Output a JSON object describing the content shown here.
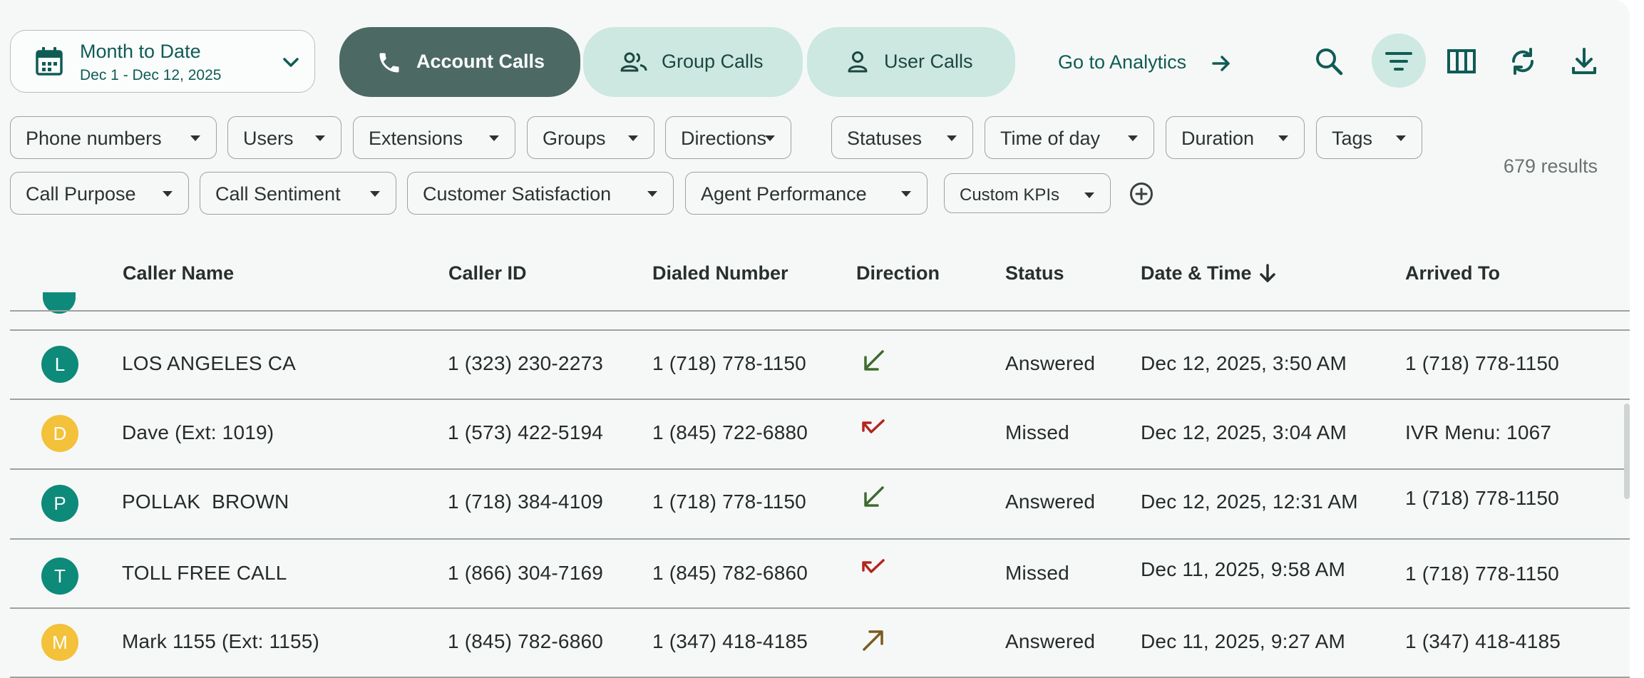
{
  "date_range": {
    "label": "Month to Date",
    "range": "Dec 1 - Dec 12, 2025"
  },
  "view_tabs": [
    {
      "label": "Account Calls",
      "active": true
    },
    {
      "label": "Group Calls",
      "active": false
    },
    {
      "label": "User Calls",
      "active": false
    }
  ],
  "analytics_link": "Go to Analytics",
  "toolbar": [
    "search-icon",
    "filter-icon",
    "columns-icon",
    "refresh-icon",
    "download-icon"
  ],
  "filters": {
    "row1": [
      "Phone numbers",
      "Users",
      "Extensions",
      "Groups",
      "Directions",
      "Statuses",
      "Time of day",
      "Duration",
      "Tags"
    ],
    "row2": [
      "Call Purpose",
      "Call Sentiment",
      "Customer Satisfaction",
      "Agent Performance",
      "Custom KPIs"
    ]
  },
  "results_count": "679 results",
  "table": {
    "columns": [
      "Caller Name",
      "Caller ID",
      "Dialed Number",
      "Direction",
      "Status",
      "Date & Time",
      "Arrived To"
    ],
    "sort_column": "Date & Time",
    "sort_direction": "descending",
    "rows": [
      {
        "initial": "L",
        "avatar_color": "#0d8a7a",
        "caller_name": "LOS ANGELES CA",
        "caller_id": "1 (323) 230-2273",
        "dialed": "1 (718) 778-1150",
        "direction": "inbound-answered",
        "status": "Answered",
        "datetime": "Dec 12, 2025, 3:50 AM",
        "arrived_to": "1 (718) 778-1150"
      },
      {
        "initial": "D",
        "avatar_color": "#f3c13a",
        "caller_name": "Dave (Ext: 1019)",
        "caller_id": "1 (573) 422-5194",
        "dialed": "1 (845) 722-6880",
        "direction": "missed",
        "status": "Missed",
        "datetime": "Dec 12, 2025, 3:04 AM",
        "arrived_to": "IVR Menu: 1067"
      },
      {
        "initial": "P",
        "avatar_color": "#0d8a7a",
        "caller_name": "POLLAK  BROWN",
        "caller_id": "1 (718) 384-4109",
        "dialed": "1 (718) 778-1150",
        "direction": "inbound-answered",
        "status": "Answered",
        "datetime": "Dec 12, 2025, 12:31 AM",
        "arrived_to": "1 (718) 778-1150"
      },
      {
        "initial": "T",
        "avatar_color": "#0d8a7a",
        "caller_name": "TOLL FREE CALL",
        "caller_id": "1 (866) 304-7169",
        "dialed": "1 (845) 782-6860",
        "direction": "missed",
        "status": "Missed",
        "datetime": "Dec 11, 2025, 9:58 AM",
        "arrived_to": "1 (718) 778-1150"
      },
      {
        "initial": "M",
        "avatar_color": "#f3c13a",
        "caller_name": "Mark 1155 (Ext: 1155)",
        "caller_id": "1 (845) 782-6860",
        "dialed": "1 (347) 418-4185",
        "direction": "outbound",
        "status": "Answered",
        "datetime": "Dec 11, 2025, 9:27 AM",
        "arrived_to": "1 (347) 418-4185"
      }
    ]
  },
  "colors": {
    "accent": "#0f5c55",
    "active_tab": "#4c6a63",
    "inactive_tab": "#cce8e1",
    "inbound_icon": "#3f6b2f",
    "missed_icon": "#b3261e",
    "outbound_icon": "#7a5a1f"
  }
}
